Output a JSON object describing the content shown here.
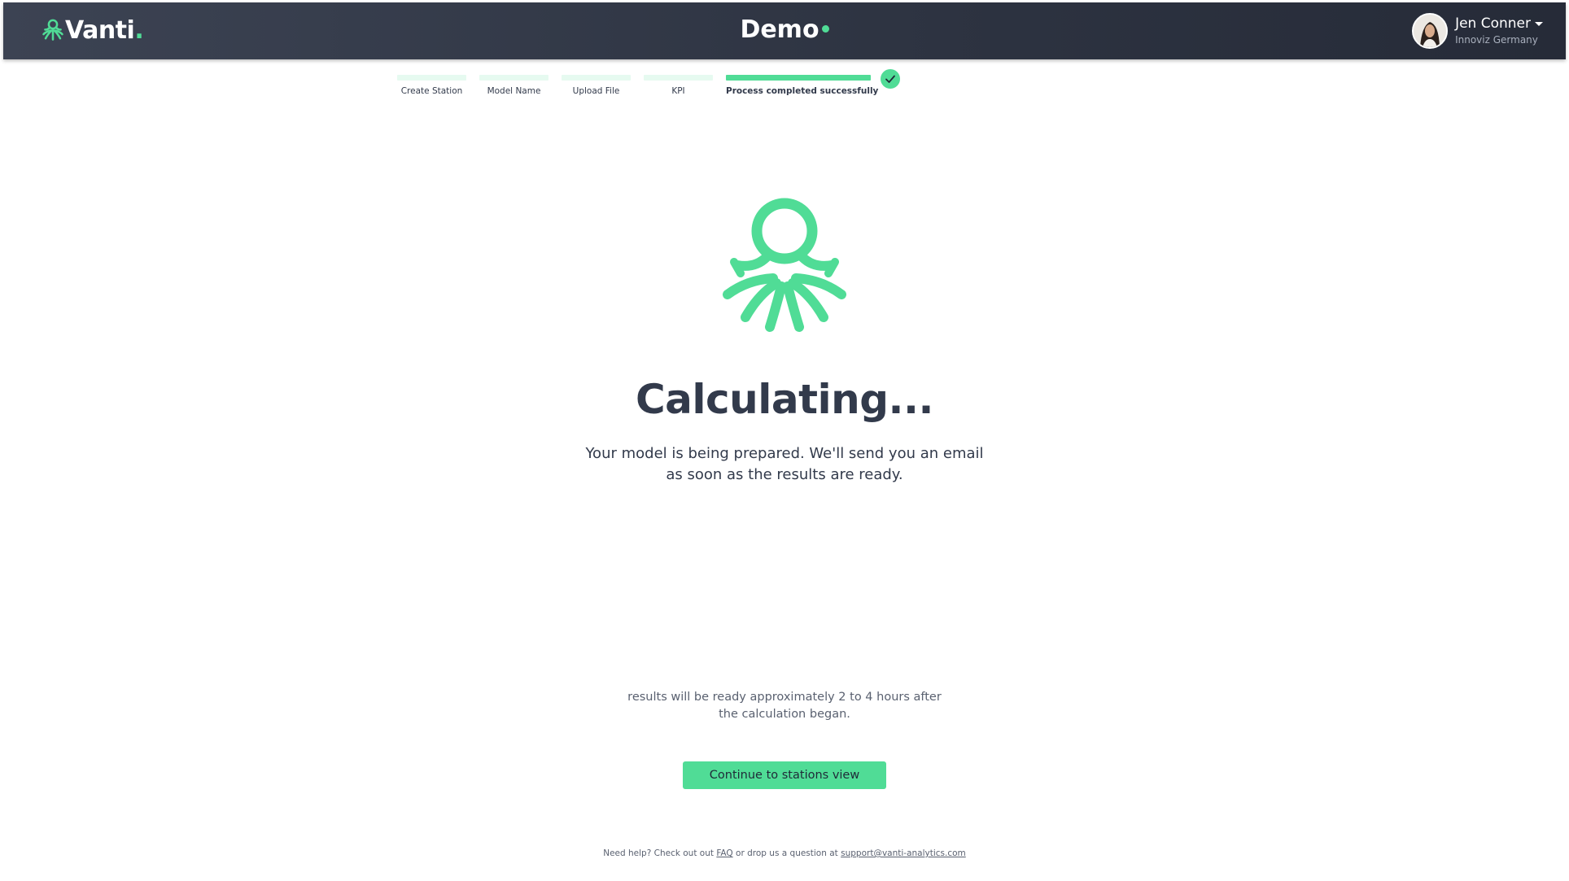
{
  "header": {
    "logo_text": "Vanti",
    "logo_dot": ".",
    "app_title": "Demo",
    "user": {
      "name": "Jen Conner",
      "org": "Innoviz Germany"
    }
  },
  "stepper": {
    "steps": [
      {
        "label": "Create Station",
        "state": "done"
      },
      {
        "label": "Model Name",
        "state": "done"
      },
      {
        "label": "Upload File",
        "state": "done"
      },
      {
        "label": "KPI",
        "state": "done"
      },
      {
        "label": "Process completed successfully",
        "state": "active"
      }
    ]
  },
  "main": {
    "headline": "Calculating...",
    "subtitle": "Your model is being prepared. We'll send you an email as soon as the results are ready.",
    "eta": "results will be ready approximately 2 to 4 hours after the calculation began.",
    "cta_label": "Continue to stations view"
  },
  "footer": {
    "help_prefix": "Need help? Check out out",
    "faq_link": "FAQ",
    "help_middle": "or drop us a question at",
    "support_email": "support@vanti-analytics.com"
  },
  "colors": {
    "accent": "#50dc96",
    "header_bg": "#2f3543",
    "text": "#323a4b"
  }
}
